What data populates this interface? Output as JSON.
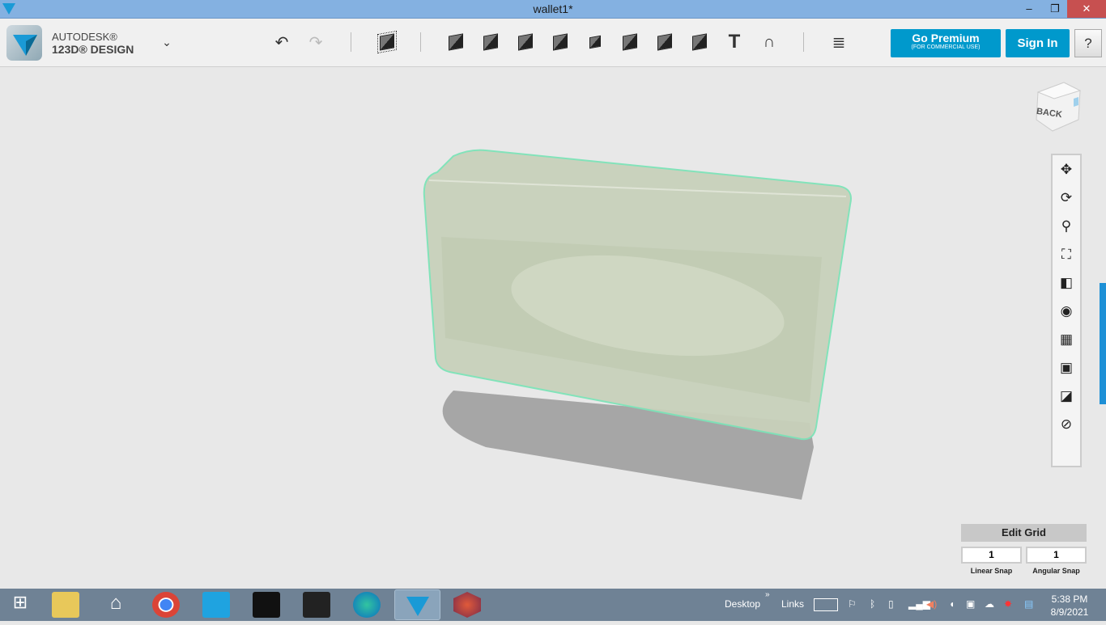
{
  "window": {
    "title": "wallet1*",
    "minimize": "‒",
    "restore": "❐",
    "close": "✕"
  },
  "brand": {
    "line1": "AUTODESK®",
    "line2": "123D® DESIGN"
  },
  "toolbar": {
    "undo": "↶",
    "redo": "↷",
    "premium_label": "Go Premium",
    "premium_sub": "(FOR COMMERCIAL USE)",
    "signin_label": "Sign In",
    "help_label": "?"
  },
  "viewcube": {
    "face": "BACK"
  },
  "edit_grid": {
    "title": "Edit Grid",
    "linear_value": "1",
    "linear_label": "Linear Snap",
    "angular_value": "1",
    "angular_label": "Angular Snap"
  },
  "taskbar": {
    "desktop": "Desktop",
    "chevron": "»",
    "links": "Links",
    "time": "5:38 PM",
    "date": "8/9/2021"
  },
  "colors": {
    "accent": "#0099cc",
    "titlebar": "#84b1e1",
    "close": "#c75050",
    "model": "#c9d3bc",
    "outline": "#7de3b8"
  }
}
